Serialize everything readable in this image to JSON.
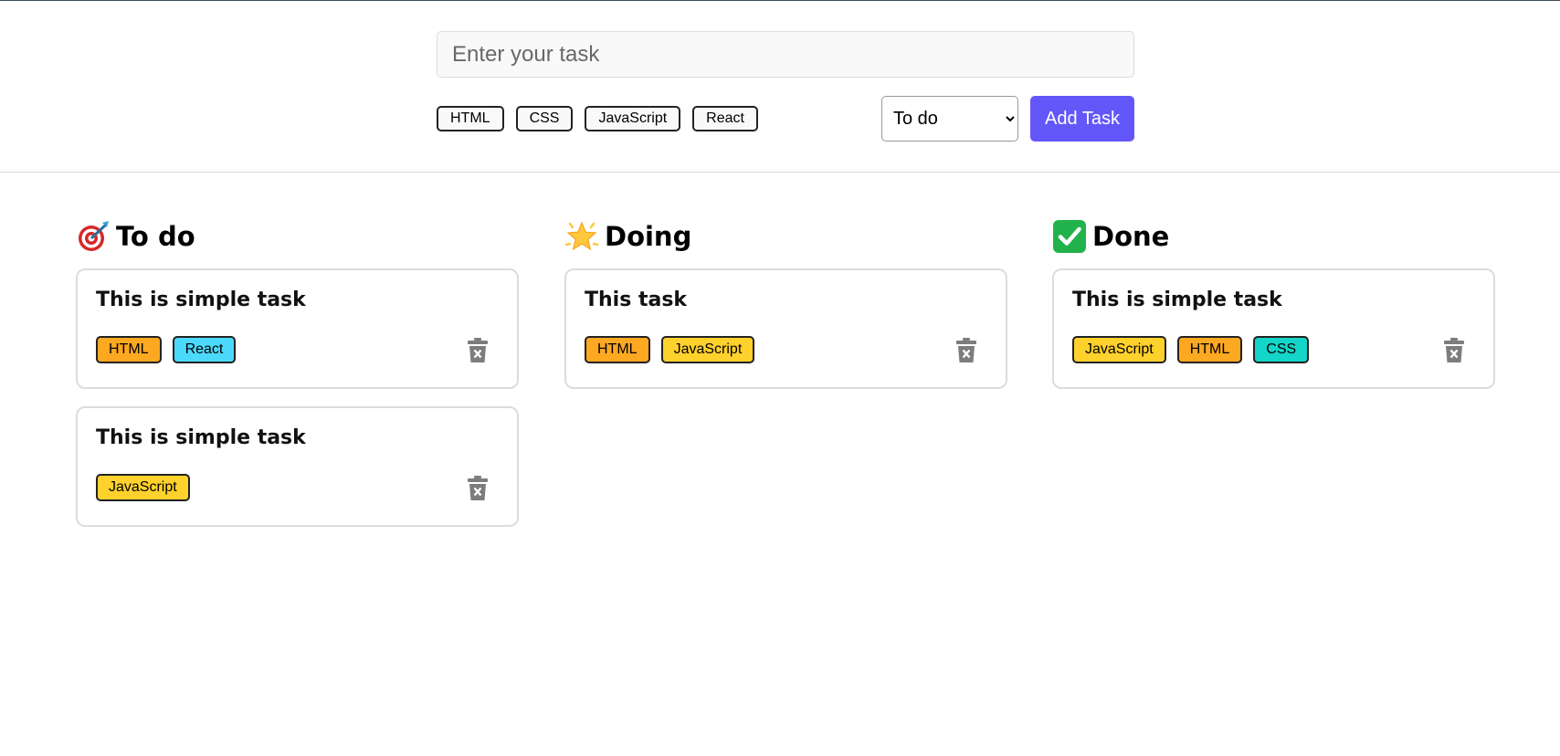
{
  "form": {
    "task_placeholder": "Enter your task",
    "task_value": "",
    "tags": [
      "HTML",
      "CSS",
      "JavaScript",
      "React"
    ],
    "status_options": [
      "To do",
      "Doing",
      "Done"
    ],
    "status_selected": "To do",
    "add_label": "Add Task"
  },
  "colors": {
    "accent": "#6457f9",
    "tag_HTML": "#fda821",
    "tag_CSS": "#15d4c8",
    "tag_JavaScript": "#ffd12c",
    "tag_React": "#4cdafc"
  },
  "columns": [
    {
      "id": "todo",
      "title": "To do",
      "icon": "target-dart-icon",
      "cards": [
        {
          "title": "This is simple task",
          "tags": [
            "HTML",
            "React"
          ]
        },
        {
          "title": "This is simple task",
          "tags": [
            "JavaScript"
          ]
        }
      ]
    },
    {
      "id": "doing",
      "title": "Doing",
      "icon": "glowing-star-icon",
      "cards": [
        {
          "title": "This task",
          "tags": [
            "HTML",
            "JavaScript"
          ]
        }
      ]
    },
    {
      "id": "done",
      "title": "Done",
      "icon": "check-mark-button-icon",
      "cards": [
        {
          "title": "This is simple task",
          "tags": [
            "JavaScript",
            "HTML",
            "CSS"
          ]
        }
      ]
    }
  ]
}
